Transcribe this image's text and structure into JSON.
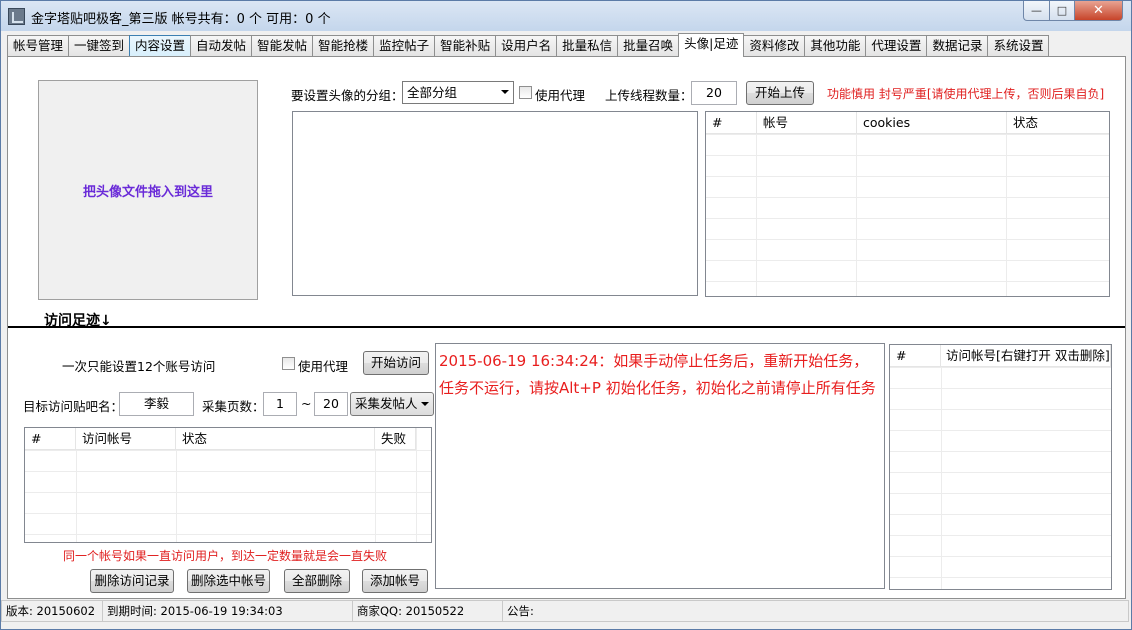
{
  "window": {
    "title": "金字塔贴吧极客_第三版    帐号共有：0 个  可用：0 个",
    "minimize": "—",
    "maximize": "□",
    "close": "✕"
  },
  "tabs": [
    "帐号管理",
    "一键签到",
    "内容设置",
    "自动发帖",
    "智能发帖",
    "智能抢楼",
    "监控帖子",
    "智能补贴",
    "设用户名",
    "批量私信",
    "批量召唤",
    "头像|足迹",
    "资料修改",
    "其他功能",
    "代理设置",
    "数据记录",
    "系统设置"
  ],
  "avatar": {
    "dropzone_text": "把头像文件拖入到这里",
    "group_label": "要设置头像的分组：",
    "group_value": "全部分组",
    "use_proxy": "使用代理",
    "threads_label": "上传线程数量：",
    "threads_value": "20",
    "start_upload": "开始上传",
    "warning": "功能慎用 封号严重[请使用代理上传，否则后果自负]",
    "table_headers": [
      "#",
      "帐号",
      "cookies",
      "状态"
    ]
  },
  "visit": {
    "section_title": "访问足迹↓",
    "note": "一次只能设置12个账号访问",
    "use_proxy": "使用代理",
    "start_visit": "开始访问",
    "bar_label": "目标访问贴吧名：",
    "bar_value": "李毅",
    "pages_label": "采集页数：",
    "page_from": "1",
    "tilde": "~",
    "page_to": "20",
    "collect_combo": "采集发帖人",
    "table_headers": [
      "#",
      "访问帐号",
      "状态",
      "失败"
    ],
    "warning": "同一个帐号如果一直访问用户，到达一定数量就是会一直失败",
    "btn_delete_records": "删除访问记录",
    "btn_delete_selected": "删除选中帐号",
    "btn_delete_all": "全部删除",
    "btn_add": "添加帐号",
    "log_text": "2015-06-19 16:34:24：如果手动停止任务后，重新开始任务，任务不运行，请按Alt+P 初始化任务，初始化之前请停止所有任务",
    "right_table_headers": [
      "#",
      "访问帐号[右键打开 双击删除]"
    ]
  },
  "status": {
    "version": "版本: 20150602",
    "expire": "到期时间: 2015-06-19 19:34:03",
    "qq": "商家QQ: 20150522",
    "notice": "公告:"
  }
}
